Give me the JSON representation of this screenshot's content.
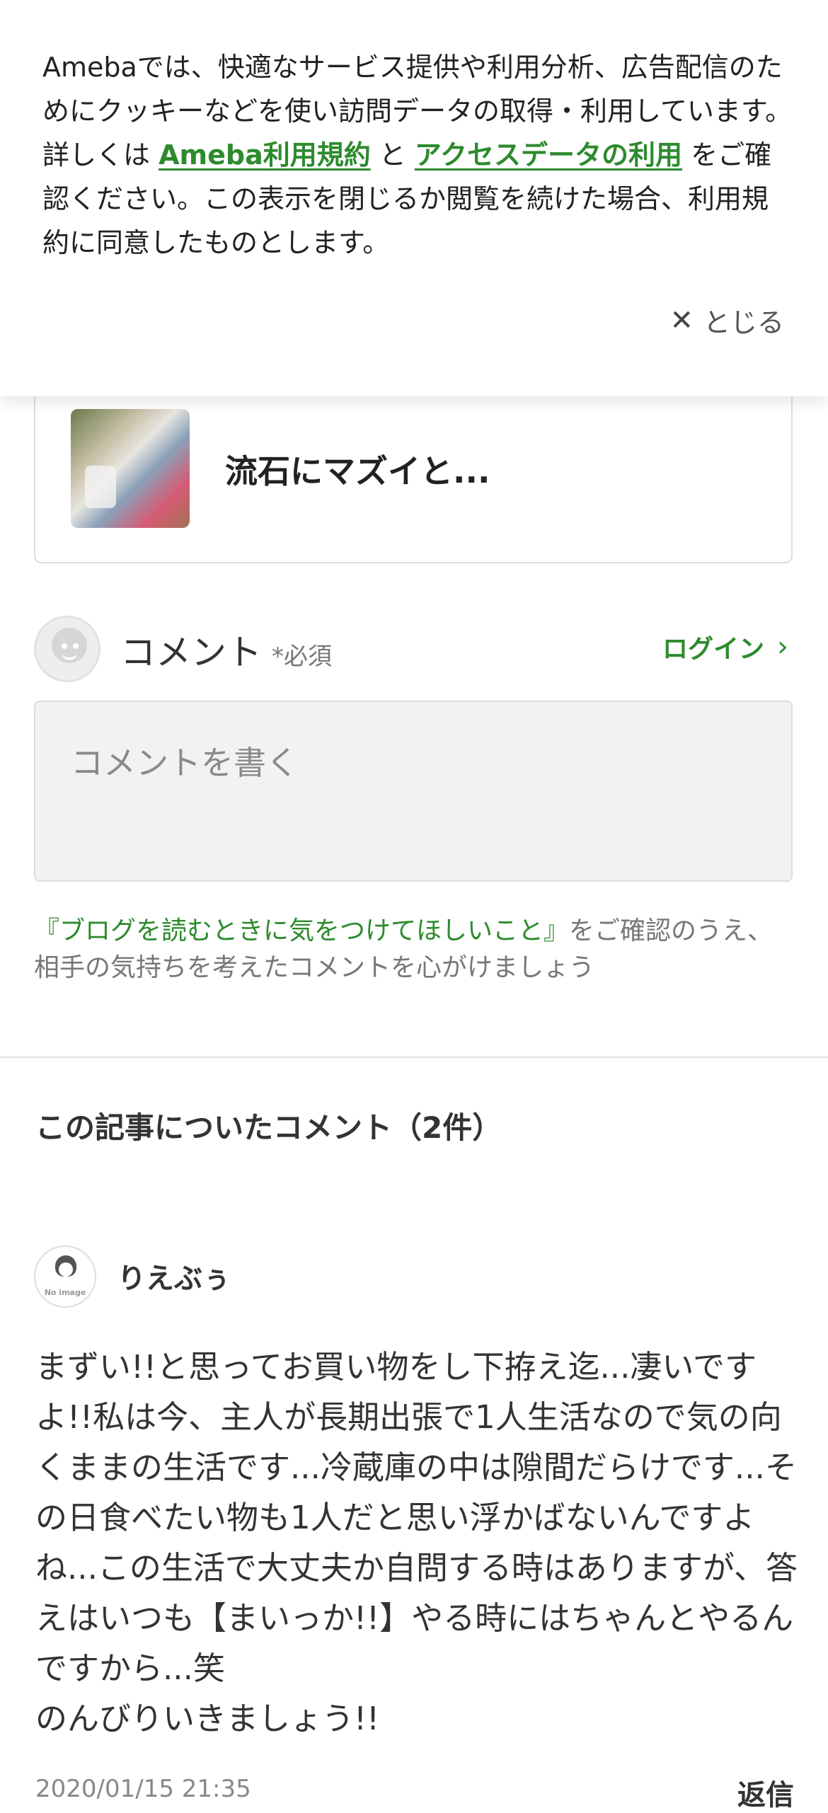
{
  "cookie_banner": {
    "text_before": "Amebaでは、快適なサービス提供や利用分析、広告配信のためにクッキーなどを使い訪問データの取得・利用しています。詳しくは ",
    "terms_link": "Ameba利用規約",
    "connector": " と ",
    "access_link": "アクセスデータの利用",
    "text_after": " をご確認ください。この表示を閉じるか閲覧を続けた場合、利用規約に同意したものとします。",
    "close_label": "とじる",
    "close_icon": "close-icon"
  },
  "related_article": {
    "title": "流石にマズイと..."
  },
  "comment_form": {
    "heading": "コメント",
    "required": "*必須",
    "login_label": "ログイン",
    "placeholder": "コメントを書く",
    "notice_link": "『ブログを読むときに気をつけてほしいこと』",
    "notice_text": "をご確認のうえ、相手の気持ちを考えたコメントを心がけましょう"
  },
  "comments": {
    "title": "この記事についたコメント（2件）",
    "items": [
      {
        "author": "りえぶぅ",
        "avatar_label": "No image",
        "body": "まずい!!と思ってお買い物をし下拵え迄...凄いですよ!!私は今、主人が長期出張で1人生活なので気の向くままの生活です...冷蔵庫の中は隙間だらけです...その日食べたい物も1人だと思い浮かばないんですよね...この生活で大丈夫か自問する時はありますが、答えはいつも【まいっか!!】やる時にはちゃんとやるんですから...笑\nのんびりいきましょう!!",
        "date": "2020/01/15 21:35",
        "reply_label": "返信"
      }
    ]
  },
  "colors": {
    "accent_green": "#2d8a2d",
    "text": "#333333",
    "muted": "#777777",
    "input_bg": "#f2f2f2"
  }
}
